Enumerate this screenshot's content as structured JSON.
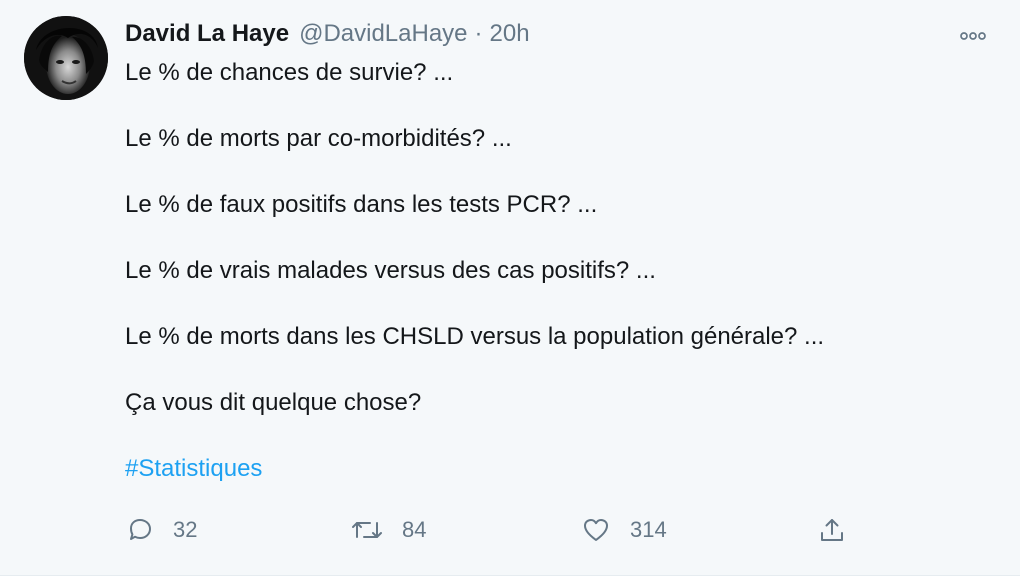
{
  "tweet": {
    "author": {
      "display_name": "David La Haye",
      "handle": "@DavidLaHaye",
      "avatar_icon": "profile-photo"
    },
    "separator": "·",
    "time": "20h",
    "more_icon": "more-options-icon",
    "paragraphs": [
      "Le % de chances de survie? ...",
      "Le % de morts par co-morbidités? ...",
      "Le % de faux positifs dans les tests PCR? ...",
      "Le % de vrais malades versus des cas positifs? ...",
      "Le % de morts dans les CHSLD versus la population générale? ...",
      "Ça vous dit quelque chose?"
    ],
    "hashtag": "#Statistiques",
    "actions": {
      "reply_icon": "reply-icon",
      "reply_count": "32",
      "retweet_icon": "retweet-icon",
      "retweet_count": "84",
      "like_icon": "heart-icon",
      "like_count": "314",
      "share_icon": "share-icon"
    }
  },
  "colors": {
    "background": "#f5f8fa",
    "text": "#14171a",
    "secondary_text": "#657786",
    "link": "#1da1f2"
  }
}
